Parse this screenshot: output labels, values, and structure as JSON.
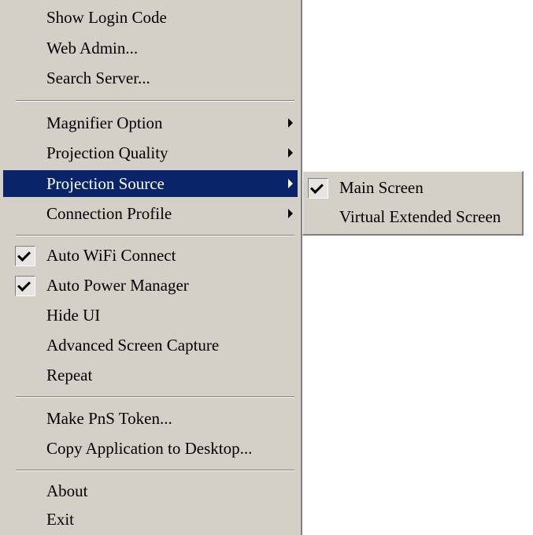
{
  "menu": {
    "items": [
      {
        "label": "Show Login Code"
      },
      {
        "label": "Web Admin..."
      },
      {
        "label": "Search Server..."
      },
      {
        "label": "Magnifier Option"
      },
      {
        "label": "Projection Quality"
      },
      {
        "label": "Projection Source"
      },
      {
        "label": "Connection Profile"
      },
      {
        "label": "Auto WiFi Connect",
        "checked": true
      },
      {
        "label": "Auto Power Manager",
        "checked": true
      },
      {
        "label": "Hide UI"
      },
      {
        "label": "Advanced Screen Capture"
      },
      {
        "label": "Repeat"
      },
      {
        "label": "Make PnS Token..."
      },
      {
        "label": "Copy Application to Desktop..."
      },
      {
        "label": "About"
      },
      {
        "label": "Exit"
      }
    ]
  },
  "submenu": {
    "items": [
      {
        "label": "Main Screen",
        "checked": true
      },
      {
        "label": "Virtual Extended Screen"
      }
    ]
  },
  "icons": {
    "check": "checkmark-icon",
    "arrow": "submenu-arrow-icon"
  },
  "colors": {
    "menu_bg": "#d4d0c8",
    "highlight_bg": "#0a246a",
    "highlight_text": "#ffffff"
  }
}
